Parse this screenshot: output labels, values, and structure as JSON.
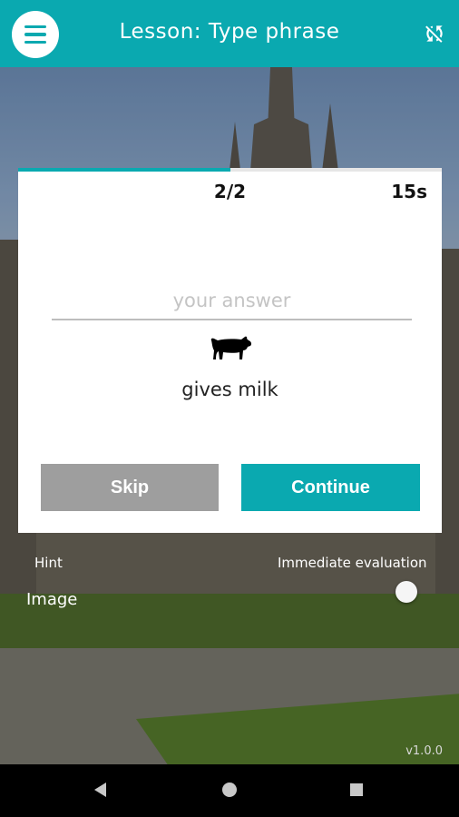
{
  "appbar": {
    "title": "Lesson: Type phrase"
  },
  "exercise": {
    "counter": "2/2",
    "timer": "15s",
    "progress": 0.5,
    "answer_placeholder": "your answer",
    "answer_value": "",
    "prompt_icon": "cow-icon",
    "prompt_text": "gives milk"
  },
  "buttons": {
    "skip": "Skip",
    "continue": "Continue"
  },
  "options": {
    "hint_label": "Hint",
    "image_label": "Image",
    "immediate_label": "Immediate evaluation",
    "immediate_on": false
  },
  "footer": {
    "version": "v1.0.0"
  },
  "colors": {
    "accent": "#0aa9b0",
    "skip": "#9e9e9e"
  }
}
